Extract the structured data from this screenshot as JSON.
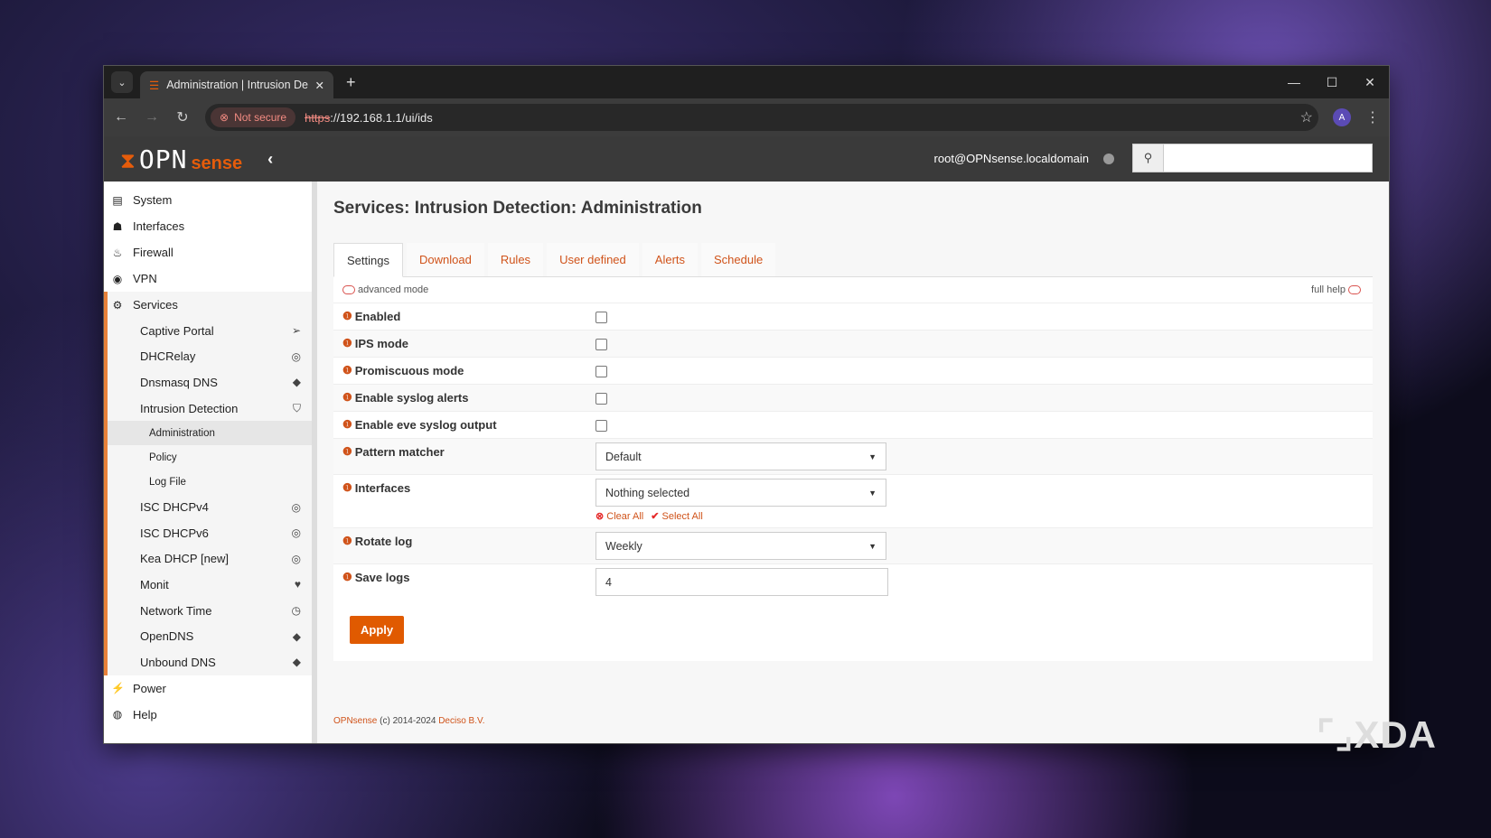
{
  "browser": {
    "tab_title": "Administration | Intrusion Dete",
    "not_secure": "Not secure",
    "url_scheme": "https",
    "url_rest": "://192.168.1.1/ui/ids",
    "profile": "A"
  },
  "header": {
    "logo": "OPNsense",
    "logo_a": "OPN",
    "logo_b": "sense",
    "user": "root@OPNsense.localdomain",
    "search_value": ""
  },
  "sidebar": {
    "top": [
      {
        "label": "System",
        "icon": "server-icon"
      },
      {
        "label": "Interfaces",
        "icon": "sitemap-icon"
      },
      {
        "label": "Firewall",
        "icon": "fire-icon"
      },
      {
        "label": "VPN",
        "icon": "globe-icon"
      }
    ],
    "services": "Services",
    "sub": [
      "Captive Portal",
      "DHCRelay",
      "Dnsmasq DNS",
      "Intrusion Detection"
    ],
    "ids_sub": [
      "Administration",
      "Policy",
      "Log File"
    ],
    "sub_after": [
      "ISC DHCPv4",
      "ISC DHCPv6",
      "Kea DHCP [new]",
      "Monit",
      "Network Time",
      "OpenDNS",
      "Unbound DNS"
    ],
    "bottom": [
      "Power",
      "Help"
    ]
  },
  "page": {
    "title": "Services: Intrusion Detection: Administration",
    "tabs": [
      "Settings",
      "Download",
      "Rules",
      "User defined",
      "Alerts",
      "Schedule"
    ],
    "advanced_mode": "advanced mode",
    "full_help": "full help",
    "checkboxes": [
      "Enabled",
      "IPS mode",
      "Promiscuous mode",
      "Enable syslog alerts",
      "Enable eve syslog output"
    ],
    "pattern_matcher": {
      "label": "Pattern matcher",
      "value": "Default"
    },
    "interfaces": {
      "label": "Interfaces",
      "value": "Nothing selected",
      "clear": "Clear All",
      "select": "Select All"
    },
    "rotate_log": {
      "label": "Rotate log",
      "value": "Weekly"
    },
    "save_logs": {
      "label": "Save logs",
      "value": "4"
    },
    "apply": "Apply"
  },
  "footer": {
    "brand": "OPNsense",
    "copy": " (c) 2014-2024 ",
    "company": "Deciso B.V."
  },
  "watermark": "XDA"
}
